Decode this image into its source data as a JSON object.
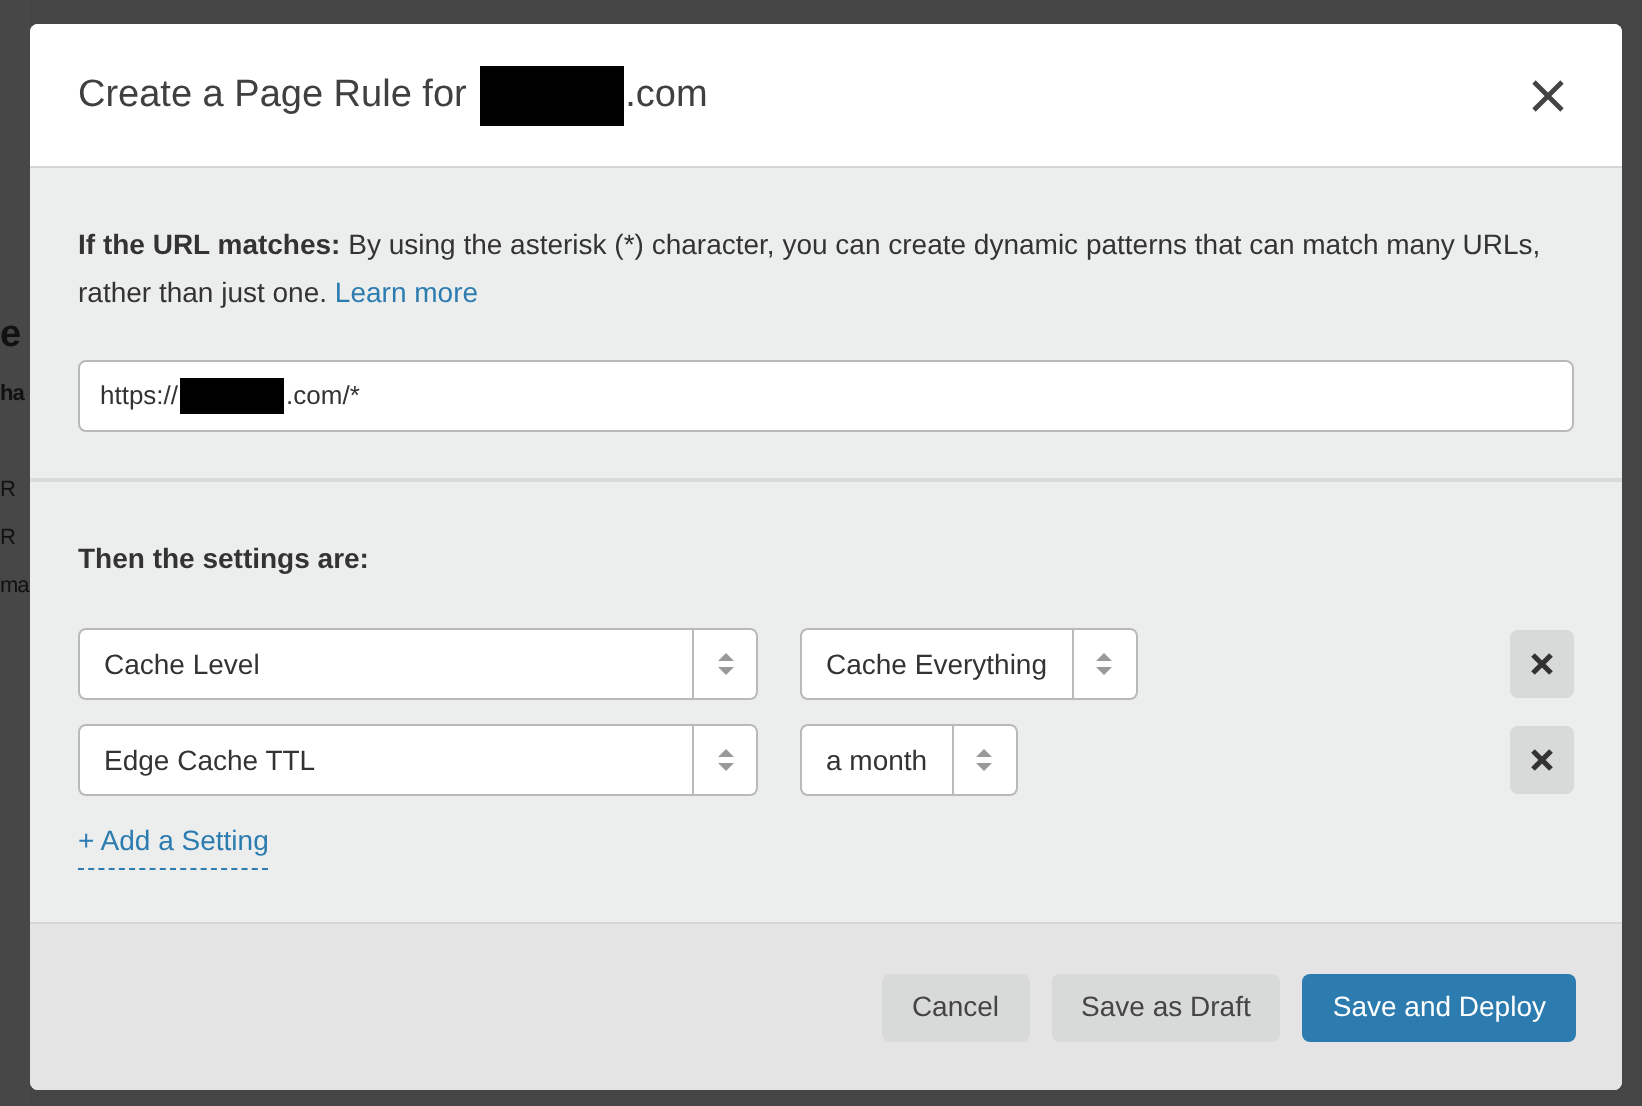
{
  "background_page": {
    "fragments": [
      {
        "text": "e",
        "kind": "heading"
      },
      {
        "text": "ha",
        "kind": "label"
      },
      {
        "text": "R",
        "kind": "plain"
      },
      {
        "text": "R",
        "kind": "plain"
      },
      {
        "text": "ma",
        "kind": "plain"
      }
    ]
  },
  "modal": {
    "title": {
      "before": "Create a Page Rule for",
      "redacted": true,
      "after": ".com"
    },
    "url_section": {
      "lead": "If the URL matches:",
      "text": "By using the asterisk (*) character, you can create dynamic patterns that can match many URLs, rather than just one.",
      "link": "Learn more",
      "field": {
        "before": "https://",
        "redacted": true,
        "after": ".com/*"
      }
    },
    "settings_section": {
      "heading": "Then the settings are:",
      "settings": [
        {
          "name": "Cache Level",
          "value": "Cache Everything"
        },
        {
          "name": "Edge Cache TTL",
          "value": "a month"
        }
      ],
      "add_link": "+ Add a Setting"
    },
    "buttons": [
      {
        "label": "Cancel",
        "kind": "secondary"
      },
      {
        "label": "Save as Draft",
        "kind": "secondary"
      },
      {
        "label": "Save and Deploy",
        "kind": "primary"
      }
    ]
  }
}
